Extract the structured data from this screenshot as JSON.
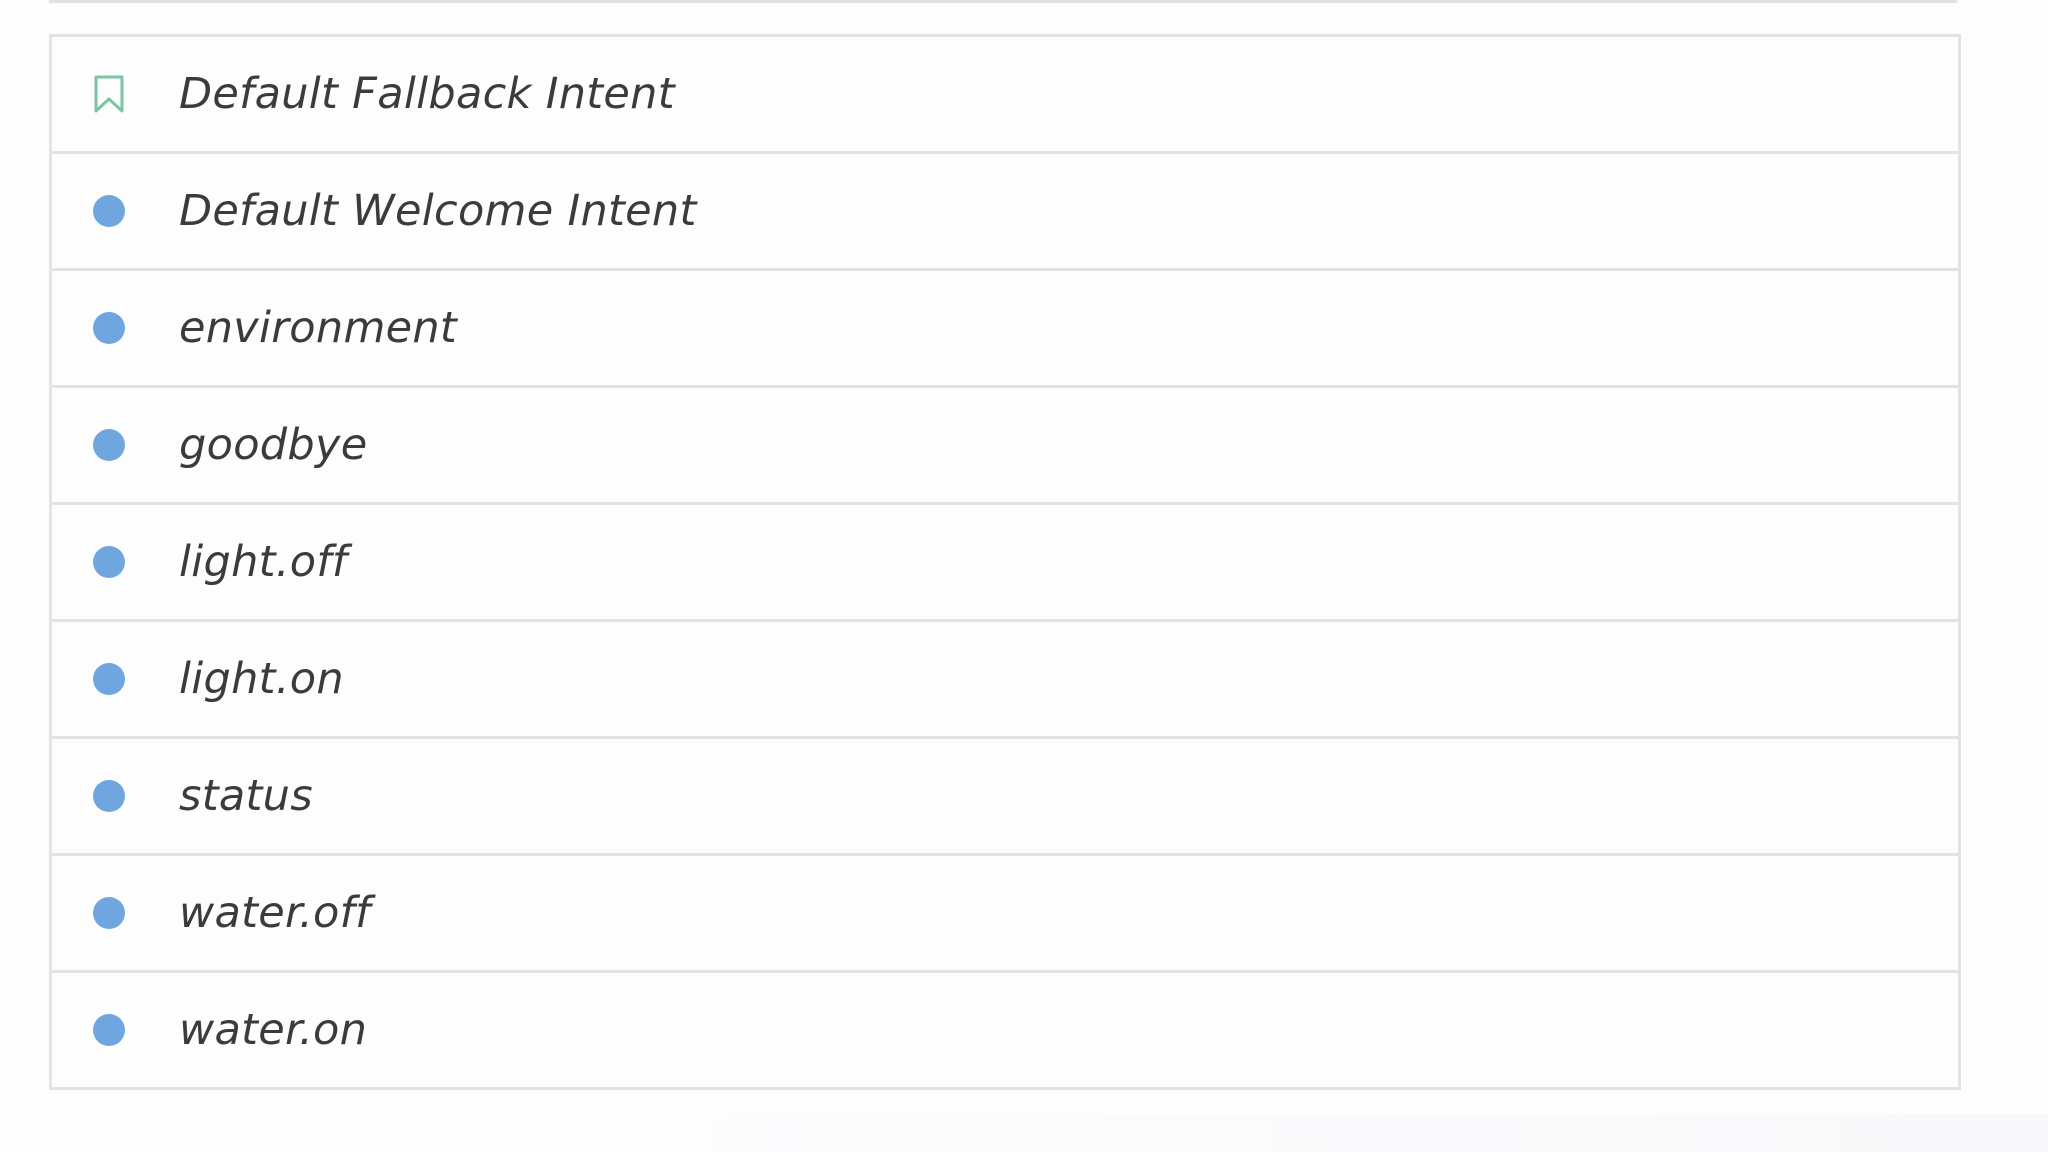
{
  "intents": [
    {
      "label": "Default Fallback Intent",
      "icon": "bookmark-icon",
      "icon_color": "#7cc4a2"
    },
    {
      "label": "Default Welcome Intent",
      "icon": "dot-icon",
      "icon_color": "#70a6e0"
    },
    {
      "label": "environment",
      "icon": "dot-icon",
      "icon_color": "#70a6e0"
    },
    {
      "label": "goodbye",
      "icon": "dot-icon",
      "icon_color": "#70a6e0"
    },
    {
      "label": "light.off",
      "icon": "dot-icon",
      "icon_color": "#70a6e0"
    },
    {
      "label": "light.on",
      "icon": "dot-icon",
      "icon_color": "#70a6e0"
    },
    {
      "label": "status",
      "icon": "dot-icon",
      "icon_color": "#70a6e0"
    },
    {
      "label": "water.off",
      "icon": "dot-icon",
      "icon_color": "#70a6e0"
    },
    {
      "label": "water.on",
      "icon": "dot-icon",
      "icon_color": "#70a6e0"
    }
  ],
  "colors": {
    "border": "#e3e3e5",
    "text": "#3a3b3d",
    "dot": "#70a6e0",
    "bookmark": "#7cc4a2"
  }
}
